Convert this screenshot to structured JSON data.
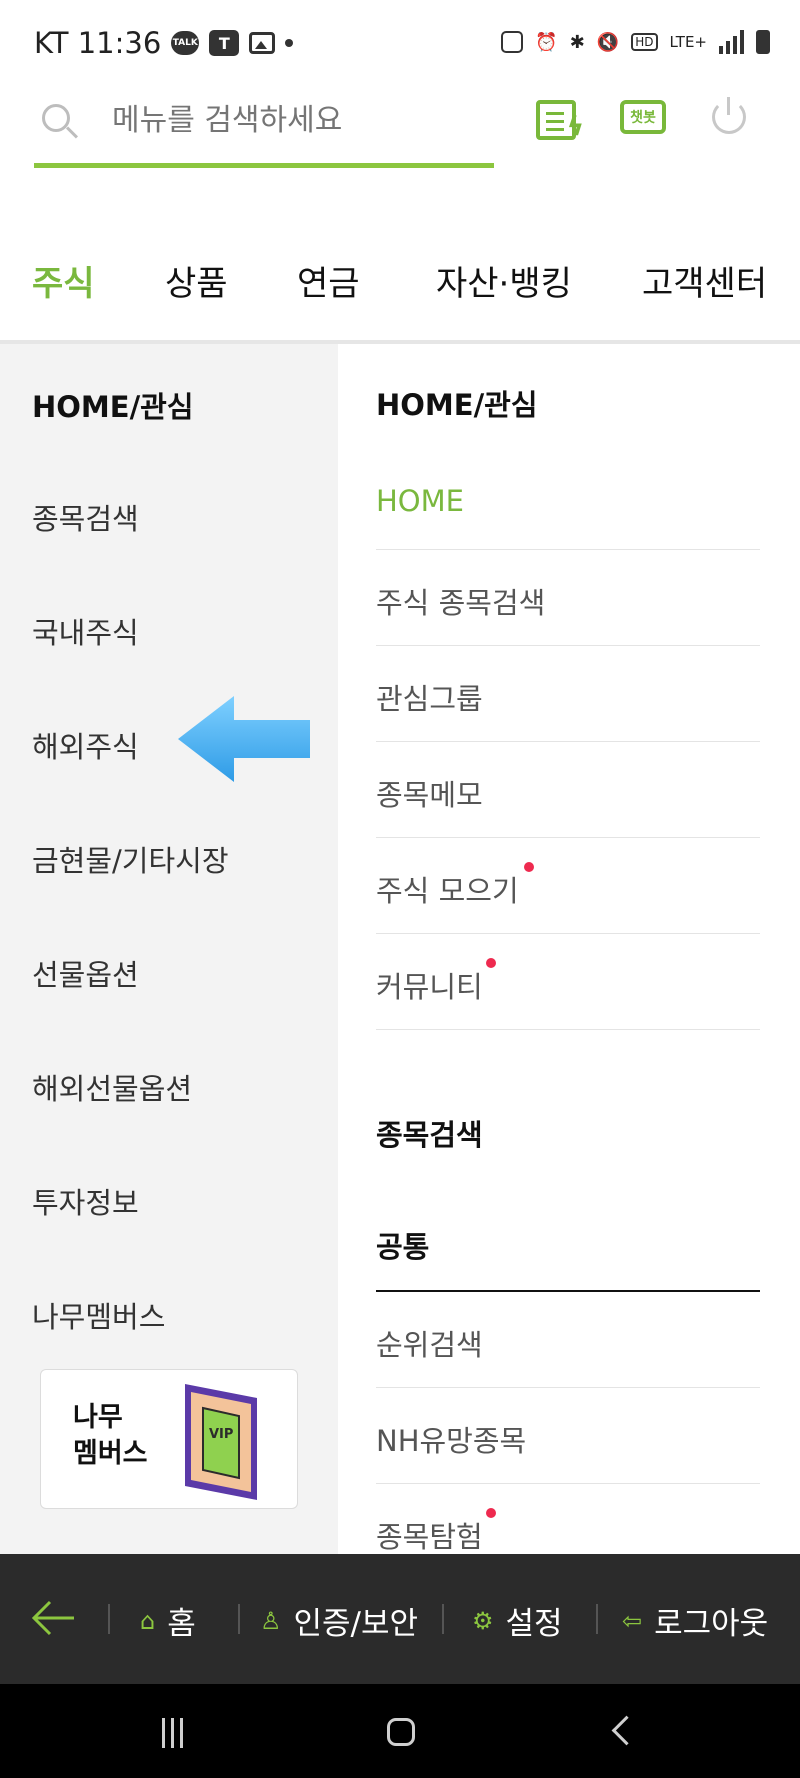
{
  "status_bar": {
    "carrier_time": "KT 11:36",
    "talk_label": "TALK",
    "teams_label": "T",
    "network": "LTE+",
    "hd_label": "HD"
  },
  "search": {
    "placeholder": "메뉴를 검색하세요",
    "chatbot_label": "챗봇"
  },
  "top_tabs": [
    {
      "label": "주식",
      "active": true
    },
    {
      "label": "상품",
      "active": false
    },
    {
      "label": "연금",
      "active": false
    },
    {
      "label": "자산·뱅킹",
      "active": false
    },
    {
      "label": "고객센터",
      "active": false
    }
  ],
  "sidebar": {
    "items": [
      {
        "label": "HOME/관심",
        "active": true
      },
      {
        "label": "종목검색"
      },
      {
        "label": "국내주식"
      },
      {
        "label": "해외주식"
      },
      {
        "label": "금현물/기타시장"
      },
      {
        "label": "선물옵션"
      },
      {
        "label": "해외선물옵션"
      },
      {
        "label": "투자정보"
      },
      {
        "label": "나무멤버스"
      }
    ],
    "banner_text": "나무\n멤버스",
    "banner_card_label": "VIP"
  },
  "panel": {
    "title": "HOME/관심",
    "items": [
      {
        "label": "HOME",
        "new": false
      },
      {
        "label": "주식 종목검색",
        "new": false
      },
      {
        "label": "관심그룹",
        "new": false
      },
      {
        "label": "종목메모",
        "new": false
      },
      {
        "label": "주식 모으기",
        "new": true
      },
      {
        "label": "커뮤니티",
        "new": true
      }
    ],
    "section_title": "종목검색",
    "sub_title": "공통",
    "sub_items": [
      {
        "label": "순위검색",
        "new": false
      },
      {
        "label": "NH유망종목",
        "new": false
      },
      {
        "label": "종목탐험",
        "new": true
      }
    ]
  },
  "bottom_bar": {
    "home": "홈",
    "auth": "인증/보안",
    "settings": "설정",
    "logout": "로그아웃"
  },
  "colors": {
    "accent": "#7ab83e",
    "new_dot": "#ee2a4f",
    "bottom_bar": "#2b2b2b"
  }
}
